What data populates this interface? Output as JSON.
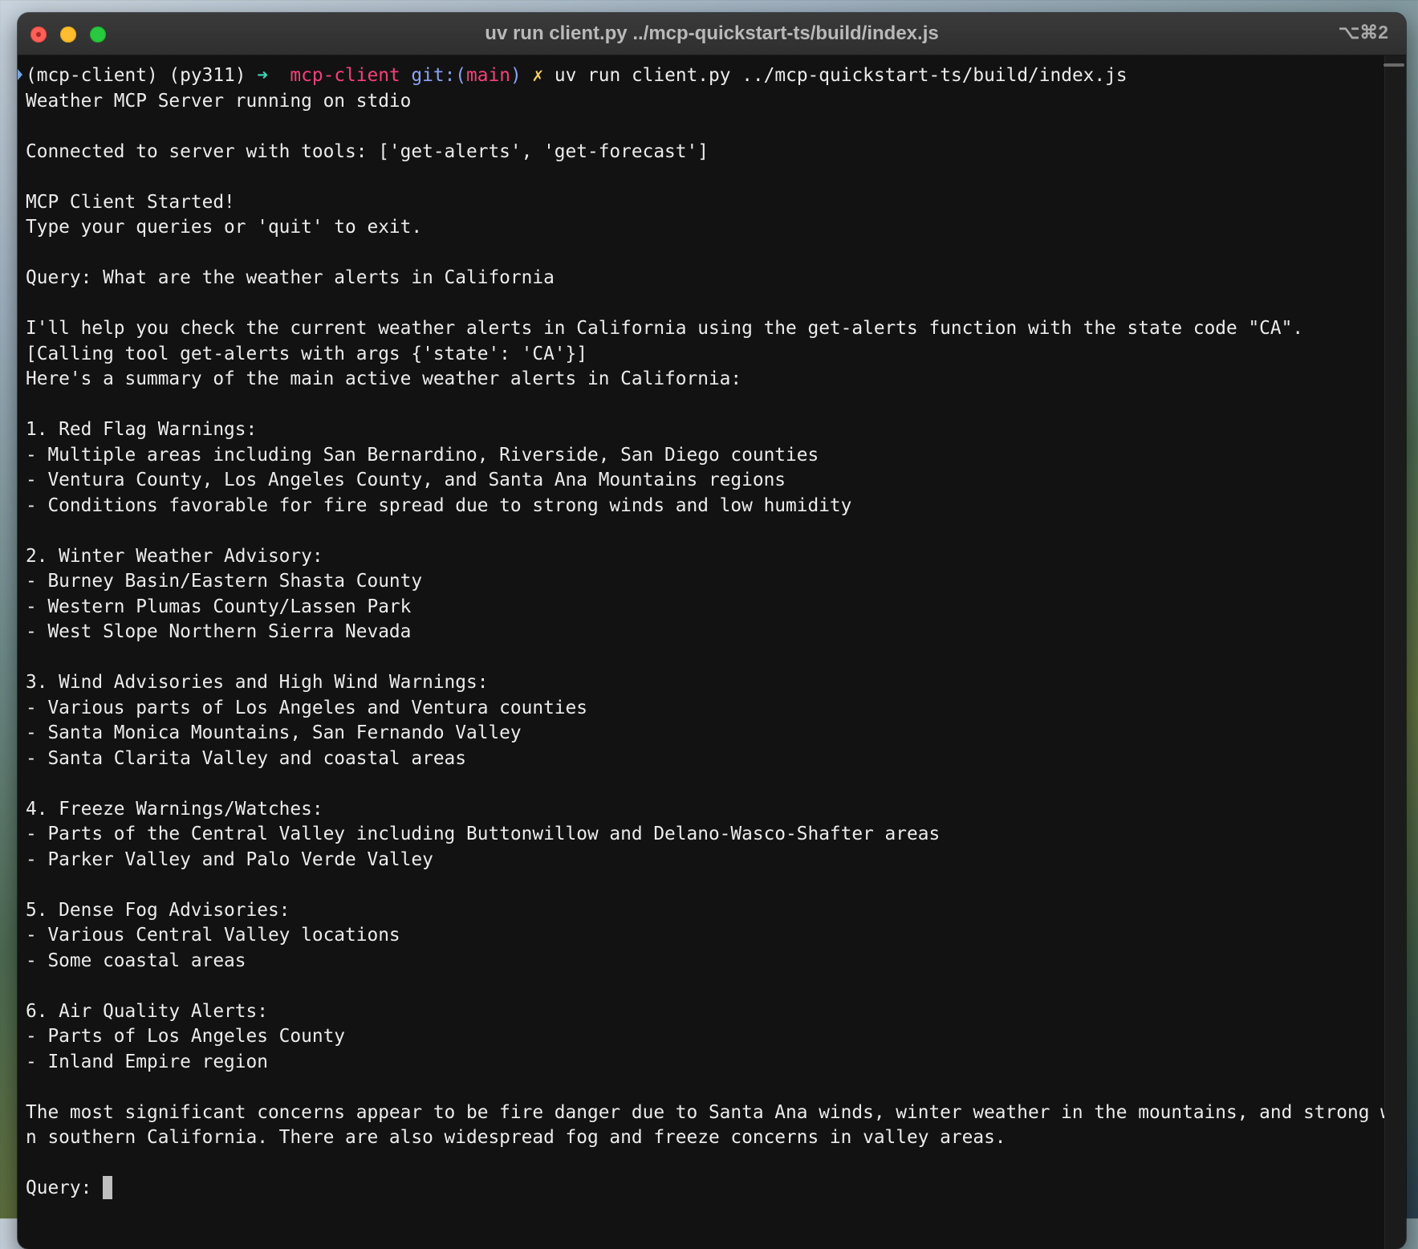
{
  "window": {
    "title": "uv run client.py ../mcp-quickstart-ts/build/index.js",
    "shortcut": "⌥⌘2"
  },
  "prompt": {
    "envs": "(mcp-client) (py311)",
    "arrow": "➜",
    "dir": "mcp-client",
    "git_label": "git:(",
    "branch": "main",
    "git_close": ")",
    "dirty": "✗",
    "command": "uv run client.py ../mcp-quickstart-ts/build/index.js"
  },
  "output": [
    "Weather MCP Server running on stdio",
    "",
    "Connected to server with tools: ['get-alerts', 'get-forecast']",
    "",
    "MCP Client Started!",
    "Type your queries or 'quit' to exit.",
    "",
    "Query: What are the weather alerts in California",
    "",
    "I'll help you check the current weather alerts in California using the get-alerts function with the state code \"CA\".",
    "[Calling tool get-alerts with args {'state': 'CA'}]",
    "Here's a summary of the main active weather alerts in California:",
    "",
    "1. Red Flag Warnings:",
    "- Multiple areas including San Bernardino, Riverside, San Diego counties",
    "- Ventura County, Los Angeles County, and Santa Ana Mountains regions",
    "- Conditions favorable for fire spread due to strong winds and low humidity",
    "",
    "2. Winter Weather Advisory:",
    "- Burney Basin/Eastern Shasta County",
    "- Western Plumas County/Lassen Park",
    "- West Slope Northern Sierra Nevada",
    "",
    "3. Wind Advisories and High Wind Warnings:",
    "- Various parts of Los Angeles and Ventura counties",
    "- Santa Monica Mountains, San Fernando Valley",
    "- Santa Clarita Valley and coastal areas",
    "",
    "4. Freeze Warnings/Watches:",
    "- Parts of the Central Valley including Buttonwillow and Delano-Wasco-Shafter areas",
    "- Parker Valley and Palo Verde Valley",
    "",
    "5. Dense Fog Advisories:",
    "- Various Central Valley locations",
    "- Some coastal areas",
    "",
    "6. Air Quality Alerts:",
    "- Parts of Los Angeles County",
    "- Inland Empire region",
    "",
    "The most significant concerns appear to be fire danger due to Santa Ana winds, winter weather in the mountains, and strong winds i",
    "n southern California. There are also widespread fog and freeze concerns in valley areas.",
    ""
  ],
  "input_prompt": "Query: ",
  "colors": {
    "background": "#121212",
    "text": "#ececec",
    "arrow": "#3ed4b4",
    "dir": "#f5407a",
    "git": "#8ba2f5",
    "dirty": "#f2cf63"
  }
}
